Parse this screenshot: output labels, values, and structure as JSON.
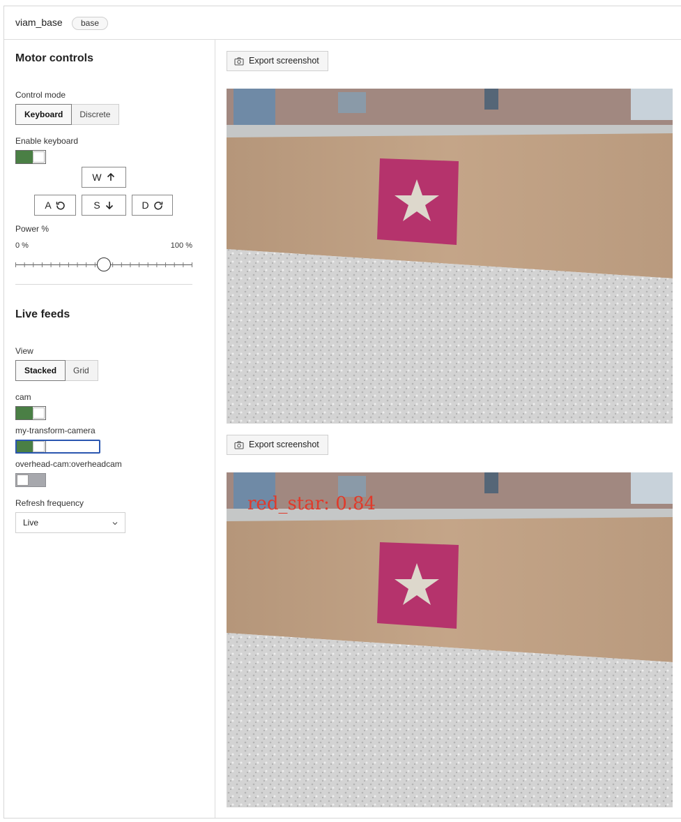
{
  "header": {
    "component_name": "viam_base",
    "component_type": "base"
  },
  "motor": {
    "title": "Motor controls",
    "control_mode_label": "Control mode",
    "modes": [
      "Keyboard",
      "Discrete"
    ],
    "selected_mode": "Keyboard",
    "enable_keyboard_label": "Enable keyboard",
    "enable_keyboard": true,
    "keys": {
      "w": "W",
      "a": "A",
      "s": "S",
      "d": "D"
    },
    "power_label": "Power %",
    "power_min": "0 %",
    "power_max": "100 %",
    "power_value": 50
  },
  "feeds": {
    "title": "Live feeds",
    "view_label": "View",
    "views": [
      "Stacked",
      "Grid"
    ],
    "selected_view": "Stacked",
    "cameras": [
      {
        "name": "cam",
        "enabled": true
      },
      {
        "name": "my-transform-camera",
        "enabled": true
      },
      {
        "name": "overhead-cam:overheadcam",
        "enabled": false
      }
    ],
    "refresh_label": "Refresh frequency",
    "refresh_value": "Live"
  },
  "streams": [
    {
      "export_label": "Export screenshot",
      "detection": ""
    },
    {
      "export_label": "Export screenshot",
      "detection": "red_star: 0.84"
    }
  ],
  "colors": {
    "toggle_on": "#4a7f45",
    "toggle_off": "#a7a8ad",
    "focus": "#2a56b0",
    "detection": "#e03a2b",
    "star_panel": "#b5336c"
  }
}
